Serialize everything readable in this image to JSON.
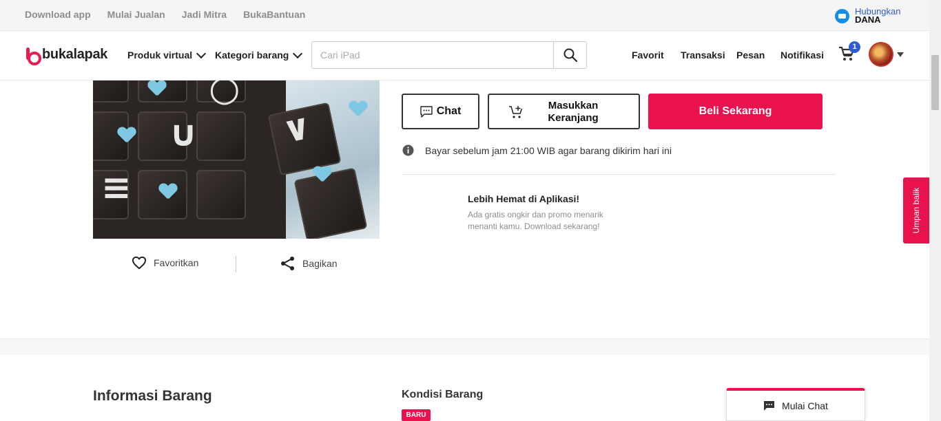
{
  "topbar": {
    "links": [
      "Download app",
      "Mulai Jualan",
      "Jadi Mitra",
      "BukaBantuan"
    ],
    "dana_line1": "Hubungkan",
    "dana_line2": "DANA"
  },
  "header": {
    "logo_text": "bukalapak",
    "produk_virtual": "Produk virtual",
    "kategori_barang": "Kategori barang",
    "search_placeholder": "Cari iPad",
    "nav": [
      "Favorit",
      "Transaksi",
      "Pesan",
      "Notifikasi"
    ],
    "cart_count": "1"
  },
  "product": {
    "favorite_label": "Favoritkan",
    "share_label": "Bagikan",
    "chat_label": "Chat",
    "cart_label": "Masukkan Keranjang",
    "buy_label": "Beli Sekarang",
    "delivery_note": "Bayar sebelum jam 21:00 WIB agar barang dikirim hari ini",
    "promo_title": "Lebih Hemat di Aplikasi!",
    "promo_desc": "Ada gratis ongkir dan promo menarik menanti kamu. Download sekarang!"
  },
  "feedback_label": "Umpan balik",
  "details": {
    "section_title": "Informasi Barang",
    "kondisi_title": "Kondisi Barang",
    "kondisi_badge": "BARU"
  },
  "chat_widget_label": "Mulai Chat",
  "colors": {
    "brand": "#e9124e",
    "accent_blue": "#2c5bd4"
  }
}
